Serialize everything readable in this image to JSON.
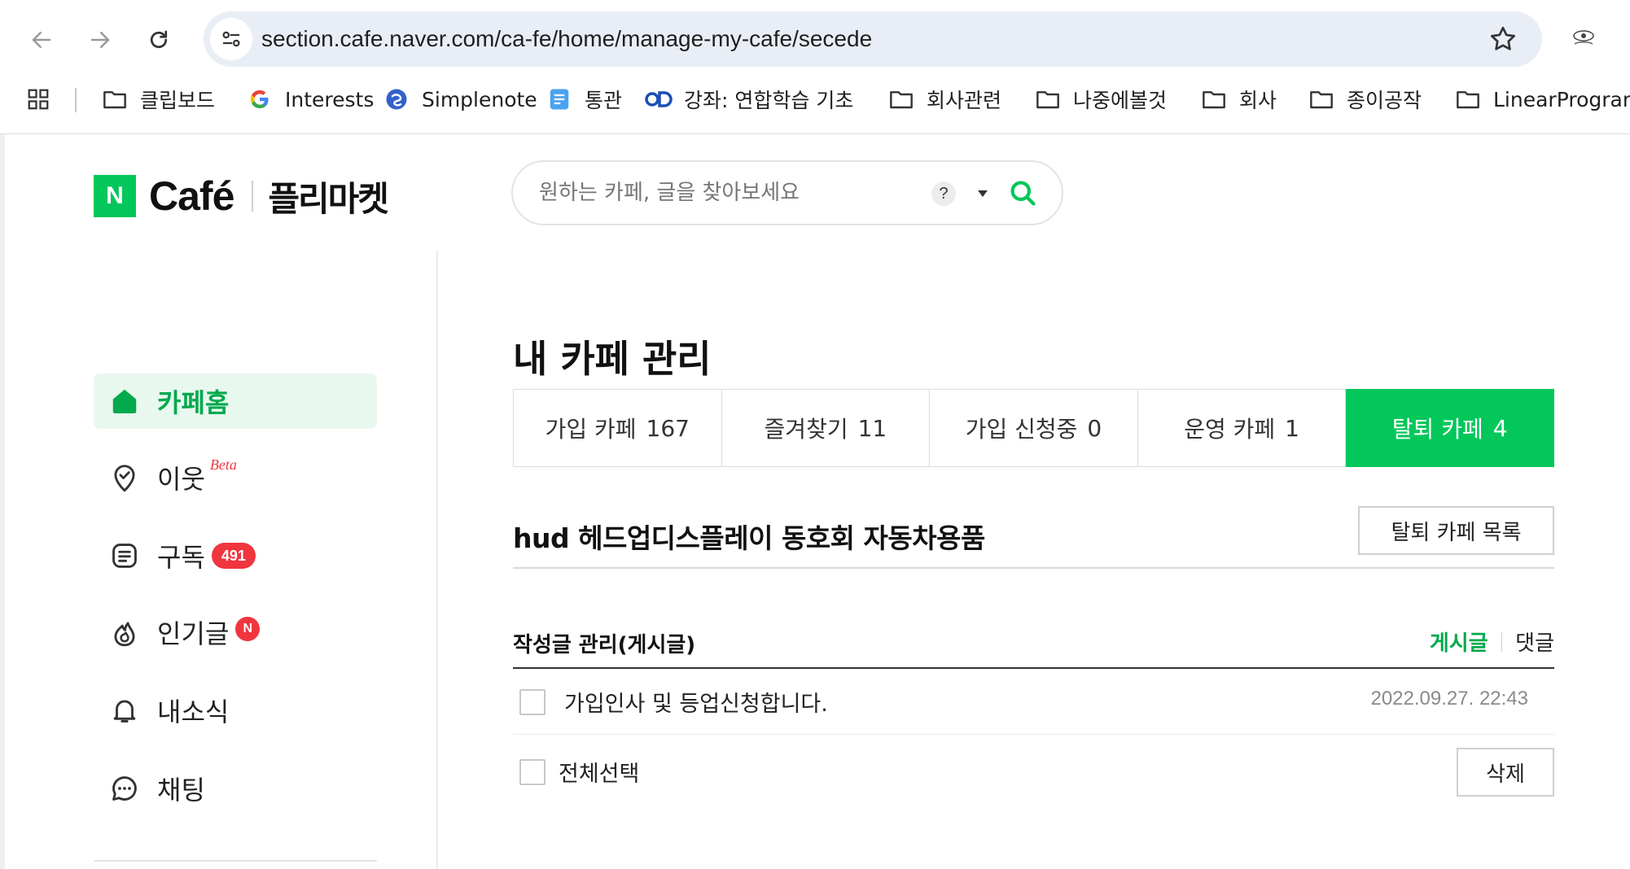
{
  "browser": {
    "url": "section.cafe.naver.com/ca-fe/home/manage-my-cafe/secede",
    "bookmarks": [
      {
        "label": "클립보드",
        "icon": "folder-icon"
      },
      {
        "label": "Interests",
        "icon": "google-icon"
      },
      {
        "label": "Simplenote",
        "icon": "simplenote-icon"
      },
      {
        "label": "통관",
        "icon": "doc-app-icon"
      },
      {
        "label": "강좌: 연합학습 기초",
        "icon": "cd-logo-icon"
      },
      {
        "label": "회사관련",
        "icon": "folder-icon"
      },
      {
        "label": "나중에볼것",
        "icon": "folder-icon"
      },
      {
        "label": "회사",
        "icon": "folder-icon"
      },
      {
        "label": "종이공작",
        "icon": "folder-icon"
      },
      {
        "label": "LinearProgramn",
        "icon": "folder-icon"
      }
    ]
  },
  "header": {
    "logo_n": "N",
    "logo_cafe": "Café",
    "logo_market": "플리마켓",
    "search_placeholder": "원하는 카페, 글을 찾아보세요",
    "help_label": "?"
  },
  "sidebar": {
    "items": [
      {
        "label": "카페홈",
        "icon": "home-icon",
        "active": true
      },
      {
        "label": "이웃",
        "icon": "location-check-icon",
        "beta": "Beta"
      },
      {
        "label": "구독",
        "icon": "document-icon",
        "badge": "491"
      },
      {
        "label": "인기글",
        "icon": "fire-icon",
        "badge": "N"
      },
      {
        "label": "내소식",
        "icon": "bell-icon"
      },
      {
        "label": "채팅",
        "icon": "chat-icon"
      }
    ]
  },
  "main": {
    "title": "내 카페 관리",
    "tabs": [
      {
        "label": "가입 카페",
        "count": "167"
      },
      {
        "label": "즐겨찾기",
        "count": "11"
      },
      {
        "label": "가입 신청중",
        "count": "0"
      },
      {
        "label": "운영 카페",
        "count": "1"
      },
      {
        "label": "탈퇴 카페",
        "count": "4",
        "active": true
      }
    ],
    "cafe_name": "hud 헤드업디스플레이 동호회 자동차용품",
    "left_list_button": "탈퇴 카페 목록",
    "section_title": "작성글 관리(게시글)",
    "sub_tabs": {
      "posts": "게시글",
      "comments": "댓글"
    },
    "posts": [
      {
        "title": "가입인사 및 등업신청합니다.",
        "date": "2022.09.27. 22:43"
      }
    ],
    "select_all": "전체선택",
    "delete_button": "삭제"
  },
  "colors": {
    "naver_green": "#03c75a",
    "badge_red": "#f0353f",
    "active_bg": "#e9f8ef"
  }
}
